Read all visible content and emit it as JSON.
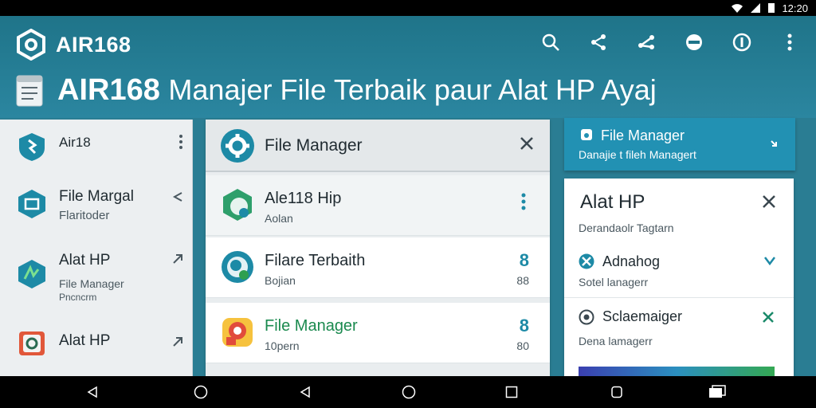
{
  "status_bar": {
    "time": "12:20"
  },
  "app_bar": {
    "brand": "AIR168",
    "headline_main": "AIR168",
    "headline_rest": "Manajer File Terbaik paur Alat HP Ayaj",
    "actions": [
      "search-icon",
      "share-network-icon",
      "share-icon",
      "lock-icon",
      "info-icon",
      "more-vert-icon"
    ]
  },
  "sidebar": {
    "items": [
      {
        "title": "Air18",
        "subtitle": "",
        "caption": "",
        "icon": "shield-icon"
      },
      {
        "title": "File Margal",
        "subtitle": "Flaritoder",
        "caption": "",
        "icon": "folder-icon"
      },
      {
        "title": "Alat HP",
        "subtitle": "File Manager",
        "caption": "Pncncrm",
        "icon": "tool-icon"
      },
      {
        "title": "Alat HP",
        "subtitle": "",
        "caption": "",
        "icon": "device-icon"
      }
    ]
  },
  "center": {
    "header_title": "File Manager",
    "rows": [
      {
        "title": "Ale118 Hip",
        "subtitle": "Aolan",
        "trail_top": "",
        "trail_bottom": ""
      },
      {
        "title": "Filare Terbaith",
        "subtitle": "Bojian",
        "trail_top": "8",
        "trail_bottom": "88"
      },
      {
        "title": "File Manager",
        "subtitle": "10pern",
        "trail_top": "8",
        "trail_bottom": "80"
      }
    ]
  },
  "right_top": {
    "title": "File Manager",
    "subtitle": "Danajie t fileh Managert"
  },
  "right_card": {
    "title": "Alat HP",
    "subtitle": "Derandaolr Tagtarn",
    "option1_title": "Adnahog",
    "option1_subtitle": "Sotel lanagerr",
    "option2_title": "Sclaemaiger",
    "option2_subtitle": "Dena lamagerr"
  },
  "colors": {
    "app_bar": "#1f7489",
    "accent": "#1d8aa6",
    "green": "#1b8a4f"
  }
}
